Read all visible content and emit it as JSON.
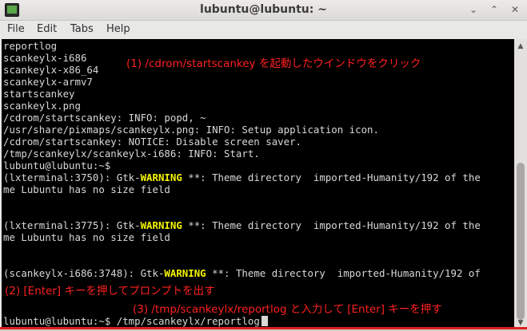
{
  "window": {
    "title": "lubuntu@lubuntu: ~",
    "minimize_glyph": "⌄",
    "maximize_glyph": "⌃",
    "close_glyph": "✕"
  },
  "menu": {
    "items": [
      "File",
      "Edit",
      "Tabs",
      "Help"
    ]
  },
  "terminal": {
    "lines": [
      "reportlog",
      "scankeylx-i686",
      "scankeylx-x86_64",
      "scankeylx-armv7",
      "startscankey",
      "scankeylx.png",
      "/cdrom/startscankey: INFO: popd, ~",
      "/usr/share/pixmaps/scankeylx.png: INFO: Setup application icon.",
      "/cdrom/startscankey: NOTICE: Disable screen saver.",
      "/tmp/scankeylx/scankeylx-i686: INFO: Start.",
      "lubuntu@lubuntu:~$"
    ],
    "warn_blocks": [
      {
        "prefix": "(lxterminal:3750): Gtk-",
        "warn": "WARNING",
        "suffix": " **: Theme directory  imported-Humanity/192 of the",
        "cont": "me Lubuntu has no size field"
      },
      {
        "prefix": "(lxterminal:3775): Gtk-",
        "warn": "WARNING",
        "suffix": " **: Theme directory  imported-Humanity/192 of the",
        "cont": "me Lubuntu has no size field"
      },
      {
        "prefix": "(scankeylx-i686:3748): Gtk-",
        "warn": "WARNING",
        "suffix": " **: Theme directory  imported-Humanity/192 of"
      }
    ],
    "prompt": "lubuntu@lubuntu:~$",
    "command": " /tmp/scankeylx/reportlog"
  },
  "annotations": {
    "step1": "(1) /cdrom/startscankey を起動したウインドウをクリック",
    "step2": "(2) [Enter] キーを押してプロンプトを出す",
    "step3": "(3) /tmp/scankeylx/reportlog と入力して [Enter] キーを押す"
  },
  "colors": {
    "terminal_bg": "#000000",
    "terminal_fg": "#d8d8d8",
    "warning": "#f4f400",
    "annotation": "#ff2020"
  }
}
